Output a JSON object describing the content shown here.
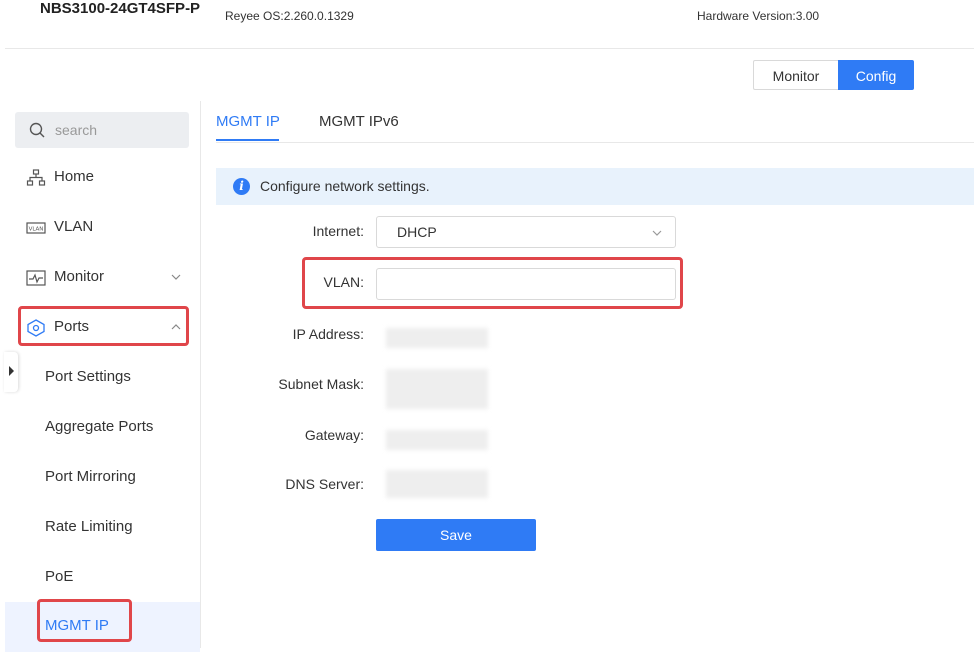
{
  "header": {
    "model": "NBS3100-24GT4SFP-P",
    "os_version": "Reyee OS:2.260.0.1329",
    "hardware_version": "Hardware Version:3.00"
  },
  "mode_switch": {
    "monitor_label": "Monitor",
    "config_label": "Config",
    "active": "Config"
  },
  "sidebar": {
    "search_placeholder": "search",
    "items": [
      {
        "label": "Home",
        "icon": "sitemap-icon"
      },
      {
        "label": "VLAN",
        "icon": "vlan-icon"
      },
      {
        "label": "Monitor",
        "icon": "pulse-icon",
        "expandable": true,
        "expanded": false
      },
      {
        "label": "Ports",
        "icon": "ports-icon",
        "expandable": true,
        "expanded": true
      }
    ],
    "subitems": [
      {
        "label": "Port Settings"
      },
      {
        "label": "Aggregate Ports"
      },
      {
        "label": "Port Mirroring"
      },
      {
        "label": "Rate Limiting"
      },
      {
        "label": "PoE"
      },
      {
        "label": "MGMT IP",
        "active": true
      }
    ]
  },
  "tabs": [
    {
      "label": "MGMT IP",
      "active": true
    },
    {
      "label": "MGMT IPv6",
      "active": false
    }
  ],
  "info_text": "Configure network settings.",
  "form": {
    "internet_label": "Internet:",
    "internet_value": "DHCP",
    "vlan_label": "VLAN:",
    "vlan_value": "",
    "ip_label": "IP Address:",
    "subnet_label": "Subnet Mask:",
    "gateway_label": "Gateway:",
    "dns_label": "DNS Server:",
    "save_label": "Save"
  },
  "colors": {
    "accent": "#2f7bf5",
    "highlight": "#e0464a",
    "info_bg": "#e8f2fc"
  }
}
